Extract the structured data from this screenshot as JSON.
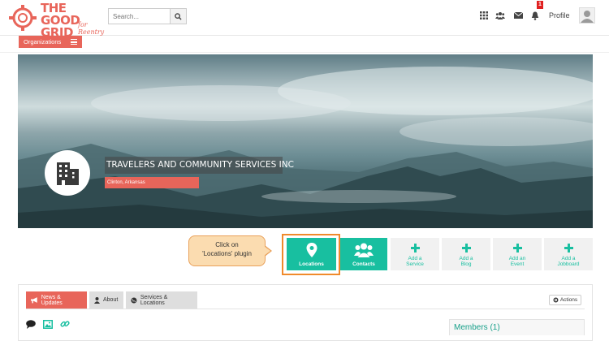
{
  "header": {
    "logo": {
      "line1": "THE",
      "line2": "GOOD",
      "line3": "GRID",
      "tagline": "for Reentry"
    },
    "search": {
      "placeholder": "Search...",
      "icon": "search-icon"
    },
    "icons": [
      "grid-icon",
      "users-icon",
      "envelope-icon",
      "bell-icon"
    ],
    "notification_count": "1",
    "profile_label": "Profile",
    "avatar_icon": "user-silhouette-icon"
  },
  "org_bar": {
    "label": "Organizations",
    "icon": "menu-icon"
  },
  "banner": {
    "org_name": "TRAVELERS AND COMMUNITY SERVICES INC",
    "location": "Clinton, Arkansas",
    "logo_icon": "building-icon"
  },
  "plugins": [
    {
      "label": "Locations",
      "icon": "map-pin-icon",
      "style": "teal"
    },
    {
      "label": "Contacts",
      "icon": "users-icon",
      "style": "teal"
    },
    {
      "label": "Add a Service",
      "icon": "plus-icon",
      "style": "grey"
    },
    {
      "label": "Add a Blog",
      "icon": "plus-icon",
      "style": "grey"
    },
    {
      "label": "Add an Event",
      "icon": "plus-icon",
      "style": "grey"
    },
    {
      "label": "Add a Jobboard",
      "icon": "plus-icon",
      "style": "grey"
    }
  ],
  "callout": {
    "line1": "Click on",
    "line2": "'Locations' plugin"
  },
  "tabs": [
    {
      "label": "News & Updates",
      "icon": "megaphone-icon",
      "active": true
    },
    {
      "label": "About",
      "icon": "user-icon",
      "active": false
    },
    {
      "label": "Services & Locations",
      "icon": "globe-icon",
      "active": false
    }
  ],
  "actions_label": "Actions",
  "panel_icons": [
    "comment-icon",
    "image-icon",
    "link-icon"
  ],
  "members_label": "Members (1)",
  "colors": {
    "accent": "#e8655a",
    "teal": "#18bfa0",
    "callout_bg": "#fbdcb0",
    "callout_border": "#f08a2b"
  }
}
